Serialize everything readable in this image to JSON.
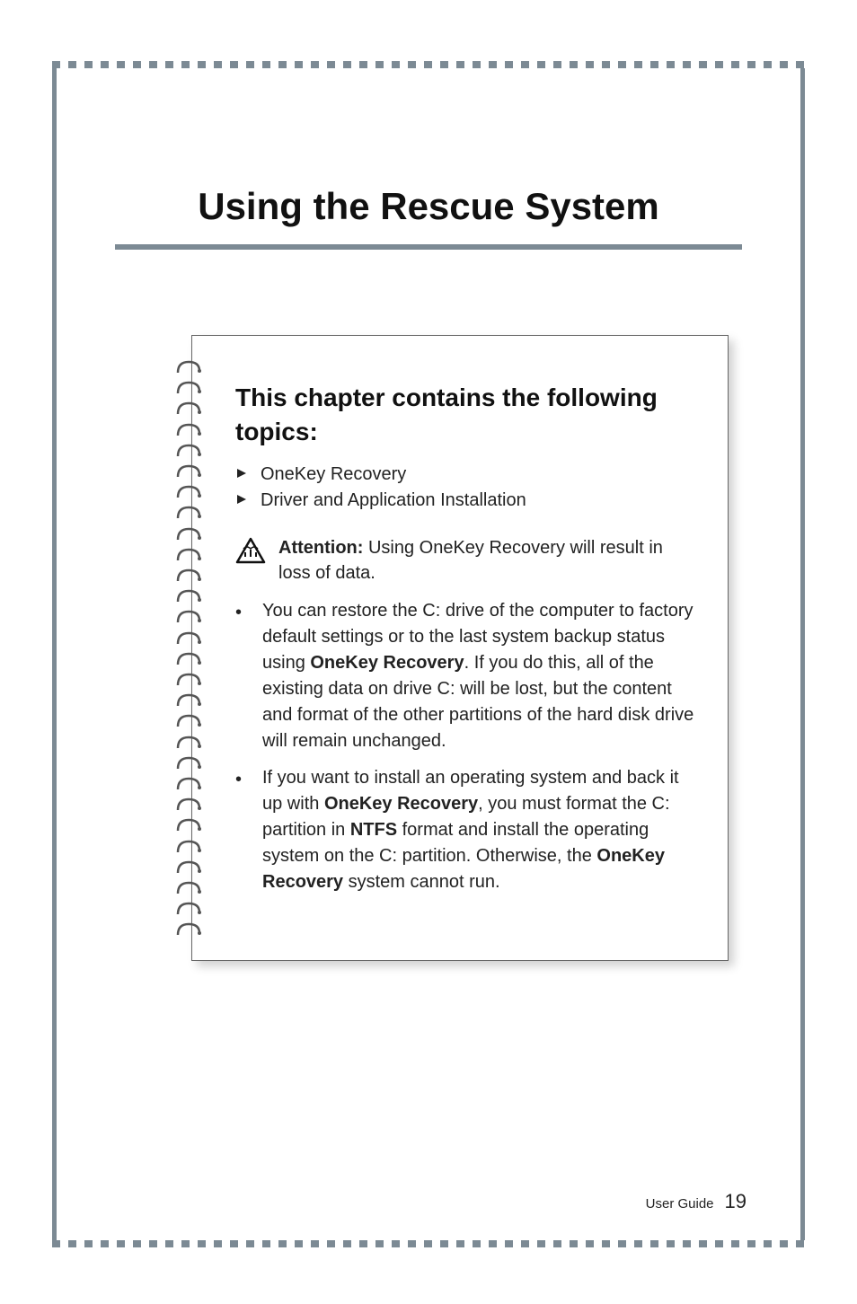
{
  "chapter": {
    "title": "Using the Rescue System"
  },
  "card": {
    "heading": "This chapter contains the following topics:",
    "topics": [
      "OneKey Recovery",
      "Driver and Application Installation"
    ],
    "attention": {
      "label": "Attention:",
      "text": " Using OneKey Recovery will result in loss of data."
    },
    "bullets": [
      {
        "pre": "You can restore the C: drive of the computer to factory default settings or to the last system backup status using ",
        "bold1": "OneKey Recovery",
        "mid": ". If you do this, all of the existing data on drive C: will be lost, but the content and format of the other partitions of the hard disk drive will remain unchanged.",
        "bold2": "",
        "post": ""
      },
      {
        "pre": "If you want to install an operating system and back it up with ",
        "bold1": "OneKey Recovery",
        "mid": ", you must format the C: partition in ",
        "bold2": "NTFS",
        "post": " format and install the operating system on the C: partition. Otherwise, the ",
        "bold3": "OneKey Recovery",
        "tail": " system cannot run."
      }
    ]
  },
  "footer": {
    "label": "User Guide",
    "page": "19"
  }
}
